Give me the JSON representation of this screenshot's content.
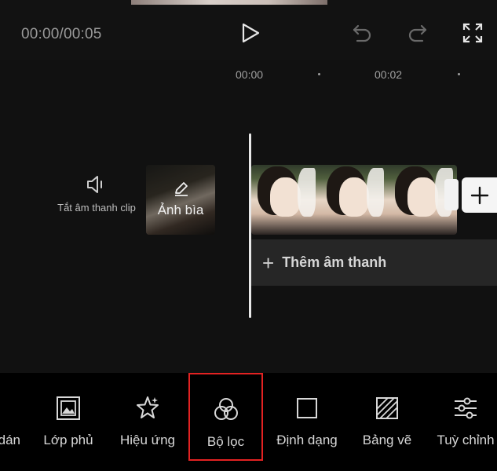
{
  "player": {
    "timecode": "00:00/00:05"
  },
  "ruler": {
    "ticks": [
      "00:00",
      "00:02"
    ]
  },
  "track": {
    "mute_label": "Tắt âm thanh clip",
    "cover_label": "Ảnh bìa",
    "add_audio_label": "Thêm âm thanh"
  },
  "toolbar": {
    "items": [
      {
        "label": "dán",
        "icon": "sticker-icon"
      },
      {
        "label": "Lớp phủ",
        "icon": "overlay-icon"
      },
      {
        "label": "Hiệu ứng",
        "icon": "effects-star-icon"
      },
      {
        "label": "Bộ lọc",
        "icon": "filter-circles-icon",
        "selected": true
      },
      {
        "label": "Định dạng",
        "icon": "format-square-icon"
      },
      {
        "label": "Bảng vẽ",
        "icon": "canvas-hatch-icon"
      },
      {
        "label": "Tuỳ chỉnh",
        "icon": "adjust-sliders-icon"
      }
    ],
    "highlight_color": "#e32222"
  },
  "colors": {
    "background": "#000000",
    "timeline": "#111111",
    "audio_track": "#262626"
  }
}
